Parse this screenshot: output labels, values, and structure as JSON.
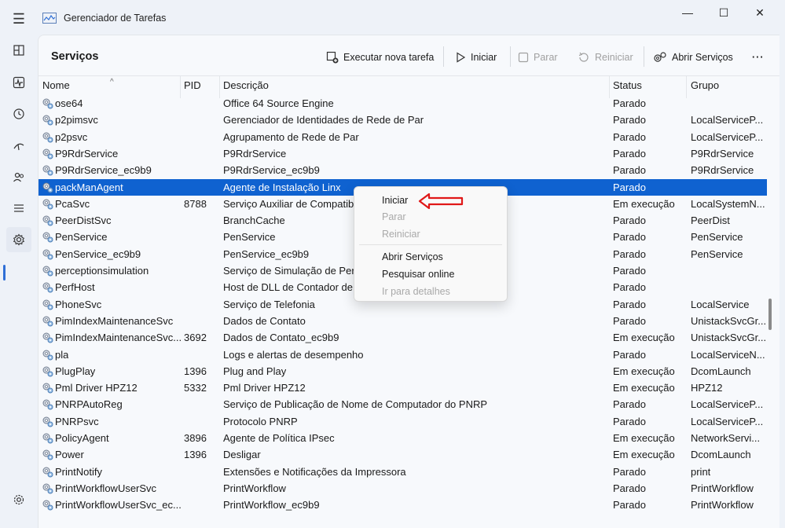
{
  "window": {
    "title": "Gerenciador de Tarefas",
    "controls": [
      "minimize",
      "maximize",
      "close"
    ]
  },
  "page": {
    "title": "Serviços"
  },
  "toolbar": {
    "run_new_task": "Executar nova tarefa",
    "start": "Iniciar",
    "stop": "Parar",
    "restart": "Reiniciar",
    "open_services": "Abrir Serviços",
    "more": "···"
  },
  "columns": {
    "name": "Nome",
    "pid": "PID",
    "description": "Descrição",
    "status": "Status",
    "group": "Grupo"
  },
  "rows": [
    {
      "name": "ose64",
      "pid": "",
      "desc": "Office 64 Source Engine",
      "status": "Parado",
      "group": ""
    },
    {
      "name": "p2pimsvc",
      "pid": "",
      "desc": "Gerenciador de Identidades de Rede de Par",
      "status": "Parado",
      "group": "LocalServiceP..."
    },
    {
      "name": "p2psvc",
      "pid": "",
      "desc": "Agrupamento de Rede de Par",
      "status": "Parado",
      "group": "LocalServiceP..."
    },
    {
      "name": "P9RdrService",
      "pid": "",
      "desc": "P9RdrService",
      "status": "Parado",
      "group": "P9RdrService"
    },
    {
      "name": "P9RdrService_ec9b9",
      "pid": "",
      "desc": "P9RdrService_ec9b9",
      "status": "Parado",
      "group": "P9RdrService"
    },
    {
      "name": "packManAgent",
      "pid": "",
      "desc": "Agente de Instalação Linx",
      "status": "Parado",
      "group": "",
      "selected": true
    },
    {
      "name": "PcaSvc",
      "pid": "8788",
      "desc": "Serviço Auxiliar de Compatib",
      "status": "Em execução",
      "group": "LocalSystemN..."
    },
    {
      "name": "PeerDistSvc",
      "pid": "",
      "desc": "BranchCache",
      "status": "Parado",
      "group": "PeerDist"
    },
    {
      "name": "PenService",
      "pid": "",
      "desc": "PenService",
      "status": "Parado",
      "group": "PenService"
    },
    {
      "name": "PenService_ec9b9",
      "pid": "",
      "desc": "PenService_ec9b9",
      "status": "Parado",
      "group": "PenService"
    },
    {
      "name": "perceptionsimulation",
      "pid": "",
      "desc": "Serviço de Simulação de Perc",
      "status": "Parado",
      "group": ""
    },
    {
      "name": "PerfHost",
      "pid": "",
      "desc": "Host de DLL de Contador de",
      "status": "Parado",
      "group": ""
    },
    {
      "name": "PhoneSvc",
      "pid": "",
      "desc": "Serviço de Telefonia",
      "status": "Parado",
      "group": "LocalService"
    },
    {
      "name": "PimIndexMaintenanceSvc",
      "pid": "",
      "desc": "Dados de Contato",
      "status": "Parado",
      "group": "UnistackSvcGr..."
    },
    {
      "name": "PimIndexMaintenanceSvc...",
      "pid": "3692",
      "desc": "Dados de Contato_ec9b9",
      "status": "Em execução",
      "group": "UnistackSvcGr..."
    },
    {
      "name": "pla",
      "pid": "",
      "desc": "Logs e alertas de desempenho",
      "status": "Parado",
      "group": "LocalServiceN..."
    },
    {
      "name": "PlugPlay",
      "pid": "1396",
      "desc": "Plug and Play",
      "status": "Em execução",
      "group": "DcomLaunch"
    },
    {
      "name": "Pml Driver HPZ12",
      "pid": "5332",
      "desc": "Pml Driver HPZ12",
      "status": "Em execução",
      "group": "HPZ12"
    },
    {
      "name": "PNRPAutoReg",
      "pid": "",
      "desc": "Serviço de Publicação de Nome de Computador do PNRP",
      "status": "Parado",
      "group": "LocalServiceP..."
    },
    {
      "name": "PNRPsvc",
      "pid": "",
      "desc": "Protocolo PNRP",
      "status": "Parado",
      "group": "LocalServiceP..."
    },
    {
      "name": "PolicyAgent",
      "pid": "3896",
      "desc": "Agente de Política IPsec",
      "status": "Em execução",
      "group": "NetworkServi..."
    },
    {
      "name": "Power",
      "pid": "1396",
      "desc": "Desligar",
      "status": "Em execução",
      "group": "DcomLaunch"
    },
    {
      "name": "PrintNotify",
      "pid": "",
      "desc": "Extensões e Notificações da Impressora",
      "status": "Parado",
      "group": "print"
    },
    {
      "name": "PrintWorkflowUserSvc",
      "pid": "",
      "desc": "PrintWorkflow",
      "status": "Parado",
      "group": "PrintWorkflow"
    },
    {
      "name": "PrintWorkflowUserSvc_ec...",
      "pid": "",
      "desc": "PrintWorkflow_ec9b9",
      "status": "Parado",
      "group": "PrintWorkflow"
    }
  ],
  "context_menu": {
    "items": [
      {
        "label": "Iniciar",
        "enabled": true
      },
      {
        "label": "Parar",
        "enabled": false
      },
      {
        "label": "Reiniciar",
        "enabled": false
      },
      {
        "label": "Abrir Serviços",
        "enabled": true
      },
      {
        "label": "Pesquisar online",
        "enabled": true
      },
      {
        "label": "Ir para detalhes",
        "enabled": false
      }
    ]
  },
  "colors": {
    "selection": "#0f62d0",
    "accent": "#2f6fd6",
    "annotation_arrow": "#e01818"
  }
}
